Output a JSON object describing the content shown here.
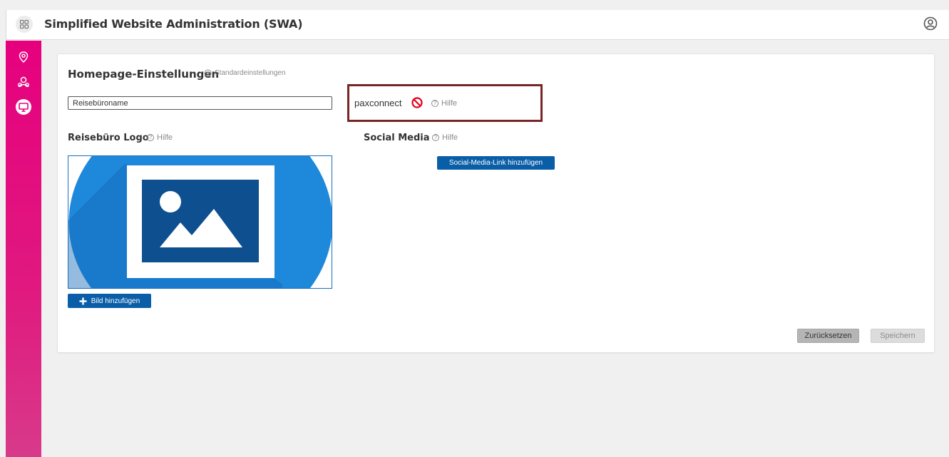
{
  "header": {
    "title": "Simplified Website Administration (SWA)",
    "launcher_icon": "grid-icon",
    "user_icon": "user-circle-icon"
  },
  "sidebar": {
    "items": [
      {
        "icon": "location-pin-icon",
        "active": false
      },
      {
        "icon": "users-icon",
        "active": false
      },
      {
        "icon": "monitor-icon",
        "active": true
      }
    ],
    "accent_color": "#e6007e"
  },
  "homepage": {
    "title": "Homepage-Einstellungen",
    "defaults_link": "Standardeinstellungen",
    "name_field": {
      "value": "Reisebüroname"
    },
    "pax": {
      "label": "paxconnect",
      "status_icon": "no-entry-icon",
      "help": "Hilfe"
    }
  },
  "logo": {
    "title": "Reisebüro Logo",
    "help": "Hilfe",
    "add_button": "Bild hinzufügen"
  },
  "social": {
    "title": "Social Media",
    "help": "Hilfe",
    "add_button": "Social-Media-Link hinzufügen"
  },
  "actions": {
    "reset": "Zurücksetzen",
    "save": "Speichern"
  },
  "colors": {
    "primary_button": "#0a5ea8",
    "highlight_border": "#7a2424",
    "disabled_red": "#e3001b"
  }
}
